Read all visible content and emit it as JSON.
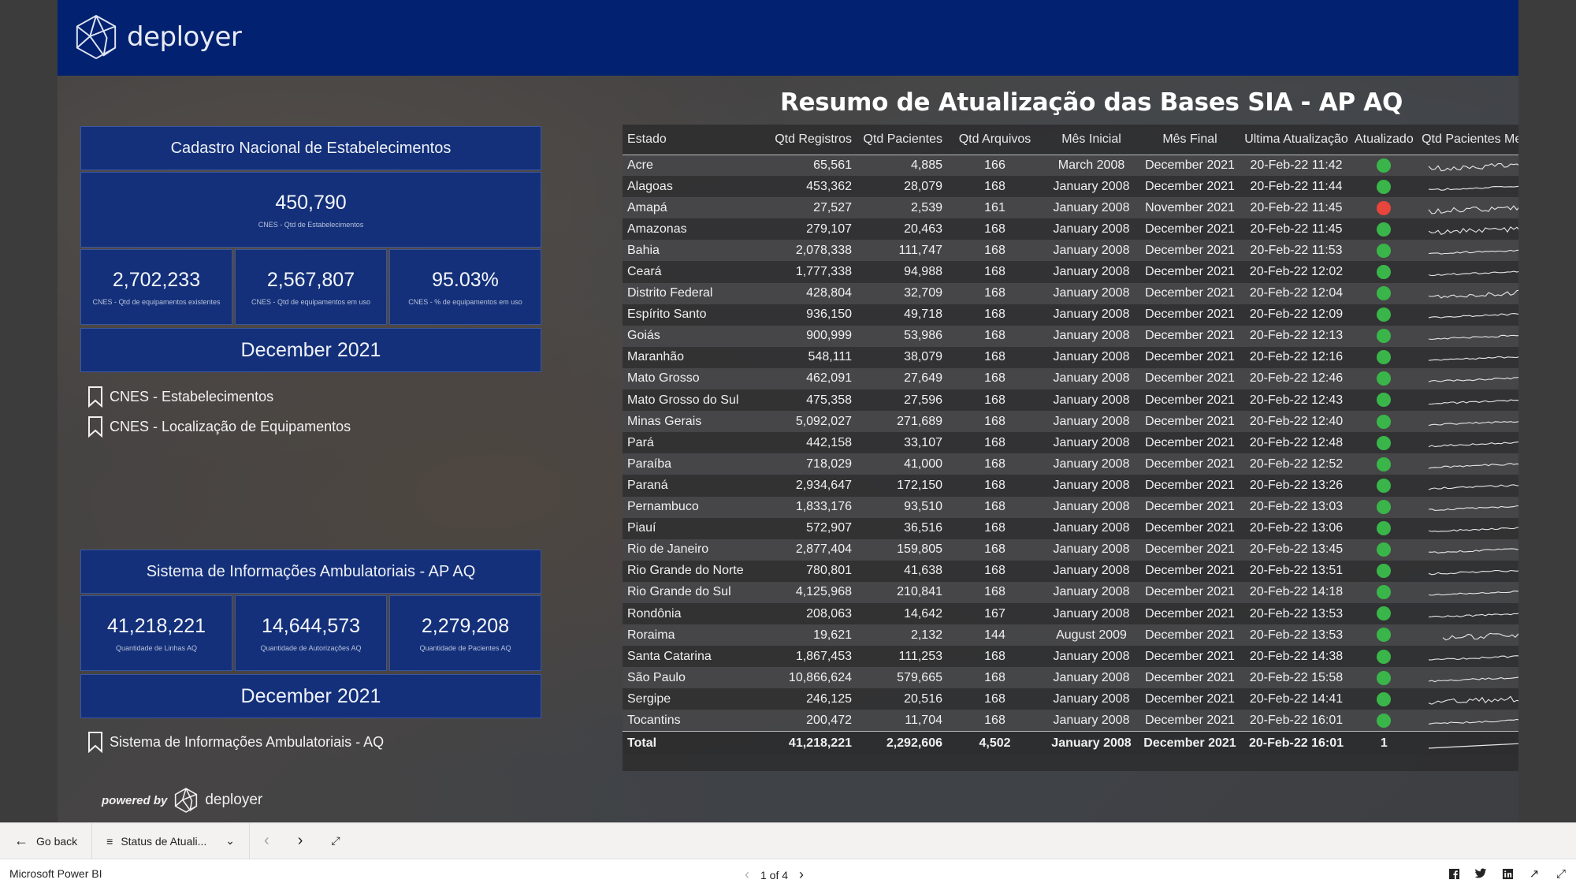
{
  "brand": {
    "name": "deployer",
    "colors": {
      "navy": "#022170",
      "panel": "#14307a",
      "green": "#3ab54a",
      "red": "#e8453c"
    }
  },
  "cnes": {
    "title": "Cadastro Nacional de Estabelecimentos",
    "kpi_main": {
      "value": "450,790",
      "caption": "CNES - Qtd de Estabelecimentos"
    },
    "kpis": [
      {
        "value": "2,702,233",
        "caption": "CNES - Qtd de equipamentos existentes"
      },
      {
        "value": "2,567,807",
        "caption": "CNES - Qtd de equipamentos em uso"
      },
      {
        "value": "95.03%",
        "caption": "CNES - % de equipamentos em uso"
      }
    ],
    "month": "December 2021",
    "links": [
      "CNES - Estabelecimentos",
      "CNES - Localização de Equipamentos"
    ]
  },
  "sia": {
    "title": "Sistema de Informações Ambulatoriais - AP AQ",
    "kpis": [
      {
        "value": "41,218,221",
        "caption": "Quantidade de Linhas AQ"
      },
      {
        "value": "14,644,573",
        "caption": "Quantidade de Autorizações AQ"
      },
      {
        "value": "2,279,208",
        "caption": "Quantidade de Pacientes AQ"
      }
    ],
    "month": "December 2021",
    "links": [
      "Sistema de Informações Ambulatoriais - AQ"
    ]
  },
  "powered": {
    "by": "powered by",
    "brand": "deployer"
  },
  "table": {
    "title": "Resumo de Atualização das Bases SIA - AP AQ",
    "columns": [
      "Estado",
      "Qtd Registros",
      "Qtd Pacientes",
      "Qtd Arquivos",
      "Mês Inicial",
      "Mês Final",
      "Ultima Atualização",
      "Atualizado",
      "Qtd Pacientes Mensais"
    ],
    "rows": [
      {
        "estado": "Acre",
        "registros": "65,561",
        "pacientes": "4,885",
        "arquivos": "166",
        "inicial": "March 2008",
        "final": "December 2021",
        "ultima": "20-Feb-22 11:42",
        "status": "green"
      },
      {
        "estado": "Alagoas",
        "registros": "453,362",
        "pacientes": "28,079",
        "arquivos": "168",
        "inicial": "January 2008",
        "final": "December 2021",
        "ultima": "20-Feb-22 11:44",
        "status": "green"
      },
      {
        "estado": "Amapá",
        "registros": "27,527",
        "pacientes": "2,539",
        "arquivos": "161",
        "inicial": "January 2008",
        "final": "November 2021",
        "ultima": "20-Feb-22 11:45",
        "status": "red"
      },
      {
        "estado": "Amazonas",
        "registros": "279,107",
        "pacientes": "20,463",
        "arquivos": "168",
        "inicial": "January 2008",
        "final": "December 2021",
        "ultima": "20-Feb-22 11:45",
        "status": "green"
      },
      {
        "estado": "Bahia",
        "registros": "2,078,338",
        "pacientes": "111,747",
        "arquivos": "168",
        "inicial": "January 2008",
        "final": "December 2021",
        "ultima": "20-Feb-22 11:53",
        "status": "green"
      },
      {
        "estado": "Ceará",
        "registros": "1,777,338",
        "pacientes": "94,988",
        "arquivos": "168",
        "inicial": "January 2008",
        "final": "December 2021",
        "ultima": "20-Feb-22 12:02",
        "status": "green"
      },
      {
        "estado": "Distrito Federal",
        "registros": "428,804",
        "pacientes": "32,709",
        "arquivos": "168",
        "inicial": "January 2008",
        "final": "December 2021",
        "ultima": "20-Feb-22 12:04",
        "status": "green"
      },
      {
        "estado": "Espírito Santo",
        "registros": "936,150",
        "pacientes": "49,718",
        "arquivos": "168",
        "inicial": "January 2008",
        "final": "December 2021",
        "ultima": "20-Feb-22 12:09",
        "status": "green"
      },
      {
        "estado": "Goiás",
        "registros": "900,999",
        "pacientes": "53,986",
        "arquivos": "168",
        "inicial": "January 2008",
        "final": "December 2021",
        "ultima": "20-Feb-22 12:13",
        "status": "green"
      },
      {
        "estado": "Maranhão",
        "registros": "548,111",
        "pacientes": "38,079",
        "arquivos": "168",
        "inicial": "January 2008",
        "final": "December 2021",
        "ultima": "20-Feb-22 12:16",
        "status": "green"
      },
      {
        "estado": "Mato Grosso",
        "registros": "462,091",
        "pacientes": "27,649",
        "arquivos": "168",
        "inicial": "January 2008",
        "final": "December 2021",
        "ultima": "20-Feb-22 12:46",
        "status": "green"
      },
      {
        "estado": "Mato Grosso do Sul",
        "registros": "475,358",
        "pacientes": "27,596",
        "arquivos": "168",
        "inicial": "January 2008",
        "final": "December 2021",
        "ultima": "20-Feb-22 12:43",
        "status": "green"
      },
      {
        "estado": "Minas Gerais",
        "registros": "5,092,027",
        "pacientes": "271,689",
        "arquivos": "168",
        "inicial": "January 2008",
        "final": "December 2021",
        "ultima": "20-Feb-22 12:40",
        "status": "green"
      },
      {
        "estado": "Pará",
        "registros": "442,158",
        "pacientes": "33,107",
        "arquivos": "168",
        "inicial": "January 2008",
        "final": "December 2021",
        "ultima": "20-Feb-22 12:48",
        "status": "green"
      },
      {
        "estado": "Paraíba",
        "registros": "718,029",
        "pacientes": "41,000",
        "arquivos": "168",
        "inicial": "January 2008",
        "final": "December 2021",
        "ultima": "20-Feb-22 12:52",
        "status": "green"
      },
      {
        "estado": "Paraná",
        "registros": "2,934,647",
        "pacientes": "172,150",
        "arquivos": "168",
        "inicial": "January 2008",
        "final": "December 2021",
        "ultima": "20-Feb-22 13:26",
        "status": "green"
      },
      {
        "estado": "Pernambuco",
        "registros": "1,833,176",
        "pacientes": "93,510",
        "arquivos": "168",
        "inicial": "January 2008",
        "final": "December 2021",
        "ultima": "20-Feb-22 13:03",
        "status": "green"
      },
      {
        "estado": "Piauí",
        "registros": "572,907",
        "pacientes": "36,516",
        "arquivos": "168",
        "inicial": "January 2008",
        "final": "December 2021",
        "ultima": "20-Feb-22 13:06",
        "status": "green"
      },
      {
        "estado": "Rio de Janeiro",
        "registros": "2,877,404",
        "pacientes": "159,805",
        "arquivos": "168",
        "inicial": "January 2008",
        "final": "December 2021",
        "ultima": "20-Feb-22 13:45",
        "status": "green"
      },
      {
        "estado": "Rio Grande do Norte",
        "registros": "780,801",
        "pacientes": "41,638",
        "arquivos": "168",
        "inicial": "January 2008",
        "final": "December 2021",
        "ultima": "20-Feb-22 13:51",
        "status": "green"
      },
      {
        "estado": "Rio Grande do Sul",
        "registros": "4,125,968",
        "pacientes": "210,841",
        "arquivos": "168",
        "inicial": "January 2008",
        "final": "December 2021",
        "ultima": "20-Feb-22 14:18",
        "status": "green"
      },
      {
        "estado": "Rondônia",
        "registros": "208,063",
        "pacientes": "14,642",
        "arquivos": "167",
        "inicial": "January 2008",
        "final": "December 2021",
        "ultima": "20-Feb-22 13:53",
        "status": "green"
      },
      {
        "estado": "Roraima",
        "registros": "19,621",
        "pacientes": "2,132",
        "arquivos": "144",
        "inicial": "August 2009",
        "final": "December 2021",
        "ultima": "20-Feb-22 13:53",
        "status": "green"
      },
      {
        "estado": "Santa Catarina",
        "registros": "1,867,453",
        "pacientes": "111,253",
        "arquivos": "168",
        "inicial": "January 2008",
        "final": "December 2021",
        "ultima": "20-Feb-22 14:38",
        "status": "green"
      },
      {
        "estado": "São Paulo",
        "registros": "10,866,624",
        "pacientes": "579,665",
        "arquivos": "168",
        "inicial": "January 2008",
        "final": "December 2021",
        "ultima": "20-Feb-22 15:58",
        "status": "green"
      },
      {
        "estado": "Sergipe",
        "registros": "246,125",
        "pacientes": "20,516",
        "arquivos": "168",
        "inicial": "January 2008",
        "final": "December 2021",
        "ultima": "20-Feb-22 14:41",
        "status": "green"
      },
      {
        "estado": "Tocantins",
        "registros": "200,472",
        "pacientes": "11,704",
        "arquivos": "168",
        "inicial": "January 2008",
        "final": "December 2021",
        "ultima": "20-Feb-22 16:01",
        "status": "green"
      }
    ],
    "total": {
      "estado": "Total",
      "registros": "41,218,221",
      "pacientes": "2,292,606",
      "arquivos": "4,502",
      "inicial": "January 2008",
      "final": "December 2021",
      "ultima": "20-Feb-22 16:01",
      "atualizado": "1"
    }
  },
  "navbar": {
    "back": "Go back",
    "page": "Status de Atuali..."
  },
  "statusbar": {
    "app": "Microsoft Power BI",
    "pager": "1 of 4"
  }
}
